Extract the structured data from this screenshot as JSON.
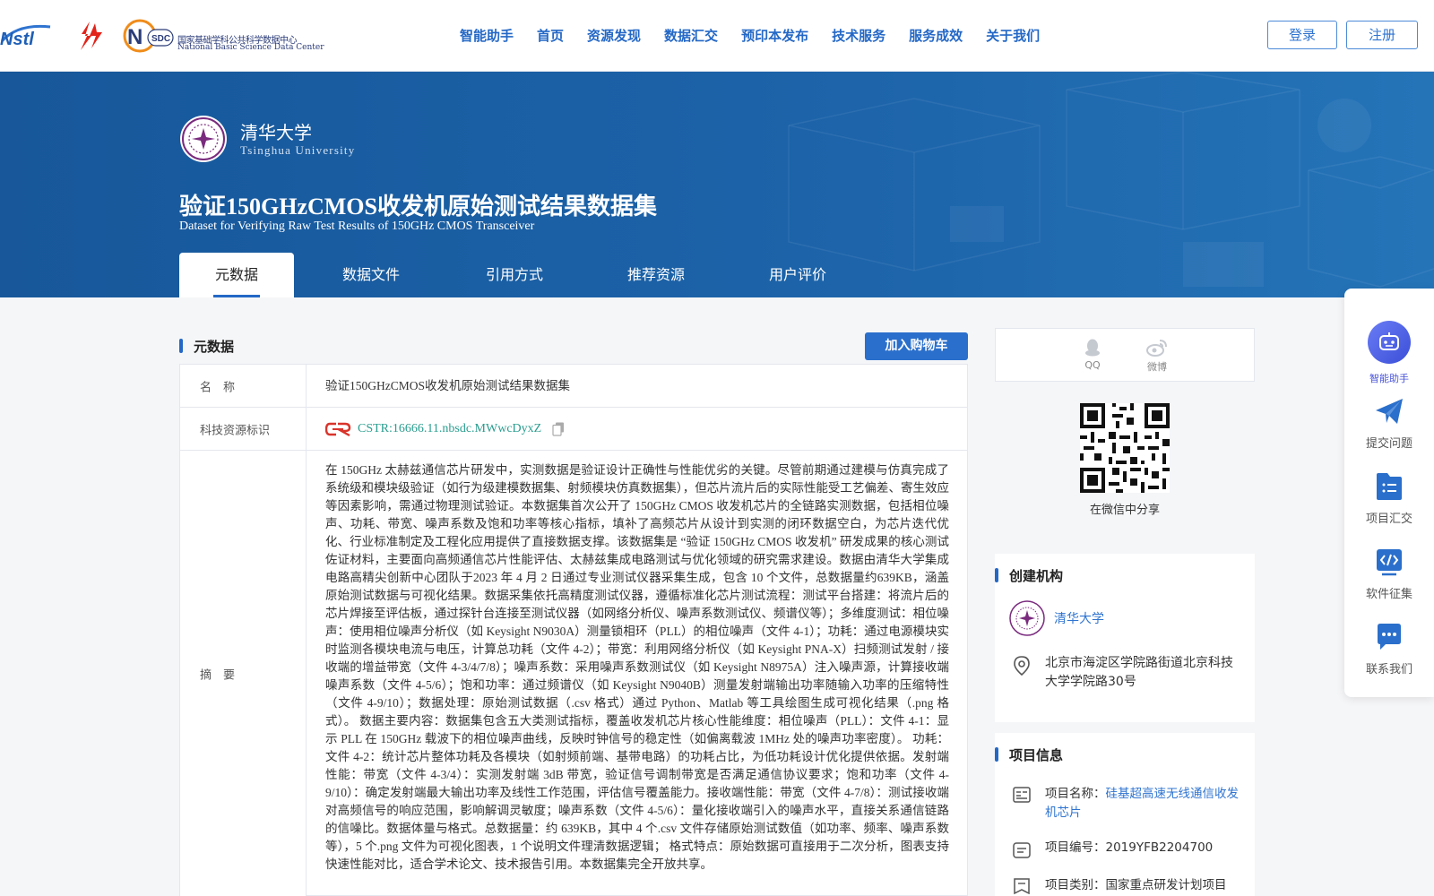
{
  "header": {
    "logos": {
      "nstl": "Nstl",
      "nsdc_badge": "SDC",
      "nsdc_cn": "国家基础学科公共科学数据中心",
      "nsdc_en": "National Basic Science Data Center"
    },
    "nav": [
      "智能助手",
      "首页",
      "资源发现",
      "数据汇交",
      "预印本发布",
      "技术服务",
      "服务成效",
      "关于我们"
    ],
    "login": "登录",
    "register": "注册"
  },
  "banner": {
    "institution_cn": "清华大学",
    "institution_en": "Tsinghua University",
    "title_cn": "验证150GHzCMOS收发机原始测试结果数据集",
    "title_en": "Dataset for Verifying Raw Test Results of 150GHz CMOS Transceiver",
    "tabs": [
      "元数据",
      "数据文件",
      "引用方式",
      "推荐资源",
      "用户评价"
    ],
    "active_tab": "元数据"
  },
  "metadata": {
    "section_title": "元数据",
    "cart_button": "加入购物车",
    "name_label": "名　称",
    "name_value": "验证150GHzCMOS收发机原始测试结果数据集",
    "id_label": "科技资源标识",
    "id_value": "CSTR:16666.11.nbsdc.MWwcDyxZ",
    "abstract_label": "摘　要",
    "abstract": "在 150GHz 太赫兹通信芯片研发中，实测数据是验证设计正确性与性能优劣的关键。尽管前期通过建模与仿真完成了系统级和模块级验证（如行为级建模数据集、射频模块仿真数据集），但芯片流片后的实际性能受工艺偏差、寄生效应等因素影响，需通过物理测试验证。本数据集首次公开了 150GHz CMOS 收发机芯片的全链路实测数据，包括相位噪声、功耗、带宽、噪声系数及饱和功率等核心指标，填补了高频芯片从设计到实测的闭环数据空白，为芯片迭代优化、行业标准制定及工程化应用提供了直接数据支撑。该数据集是 “验证 150GHz CMOS 收发机” 研发成果的核心测试佐证材料，主要面向高频通信芯片性能评估、太赫兹集成电路测试与优化领域的研究需求建设。数据由清华大学集成电路高精尖创新中心团队于2023 年 4 月 2 日通过专业测试仪器采集生成，包含 10 个文件，总数据量约639KB，涵盖原始测试数据与可视化结果。数据采集依托高精度测试仪器，遵循标准化芯片测试流程：测试平台搭建：将流片后的芯片焊接至评估板，通过探针台连接至测试仪器（如网络分析仪、噪声系数测试仪、频谱仪等）；多维度测试：相位噪声：使用相位噪声分析仪（如 Keysight N9030A）测量锁相环（PLL）的相位噪声（文件 4-1）；功耗：通过电源模块实时监测各模块电流与电压，计算总功耗（文件 4-2）；带宽：利用网络分析仪（如 Keysight PNA-X）扫频测试发射 / 接收端的增益带宽（文件 4-3/4/7/8）；噪声系数：采用噪声系数测试仪（如 Keysight N8975A）注入噪声源，计算接收端噪声系数（文件 4-5/6）；饱和功率：通过频谱仪（如 Keysight N9040B）测量发射端输出功率随输入功率的压缩特性（文件 4-9/10）；数据处理：原始测试数据（.csv 格式）通过 Python、Matlab 等工具绘图生成可视化结果（.png 格式）。 数据主要内容：数据集包含五大类测试指标，覆盖收发机芯片核心性能维度：相位噪声（PLL）：文件 4-1：显示 PLL 在 150GHz 载波下的相位噪声曲线，反映时钟信号的稳定性（如偏离载波 1MHz 处的噪声功率密度）。 功耗：文件 4-2：统计芯片整体功耗及各模块（如射频前端、基带电路）的功耗占比，为低功耗设计优化提供依据。发射端性能：带宽（文件 4-3/4）：实测发射端 3dB 带宽，验证信号调制带宽是否满足通信协议要求；饱和功率（文件 4-9/10）：确定发射端最大输出功率及线性工作范围，评估信号覆盖能力。接收端性能：带宽（文件 4-7/8）：测试接收端对高频信号的响应范围，影响解调灵敏度；噪声系数（文件 4-5/6）：量化接收端引入的噪声水平，直接关系通信链路的信噪比。数据体量与格式。总数据量：约 639KB，其中 4 个.csv 文件存储原始测试数值（如功率、频率、噪声系数等），5 个.png 文件为可视化图表，1 个说明文件理清数据逻辑； 格式特点：原始数据可直接用于二次分析，图表支持快速性能对比，适合学术论文、技术报告引用。本数据集完全开放共享。"
  },
  "sidebar": {
    "share": [
      {
        "label": "QQ",
        "icon": "qq-icon"
      },
      {
        "label": "微博",
        "icon": "weibo-icon"
      }
    ],
    "qr_caption": "在微信中分享",
    "org_card": {
      "title": "创建机构",
      "name": "清华大学",
      "address": "北京市海淀区学院路街道北京科技大学学院路30号"
    },
    "project_card": {
      "title": "项目信息",
      "name_prefix": "项目名称：",
      "name_value": "硅基超高速无线通信收发机芯片",
      "number": "项目编号：2019YFB2204700",
      "category": "项目类别：国家重点研发计划项目"
    }
  },
  "floatbar": {
    "items": [
      "智能助手",
      "提交问题",
      "项目汇交",
      "软件征集",
      "联系我们"
    ]
  },
  "colors": {
    "primary": "#2468c6",
    "banner": "#1d64aa",
    "link_teal": "#2a9d8f"
  }
}
